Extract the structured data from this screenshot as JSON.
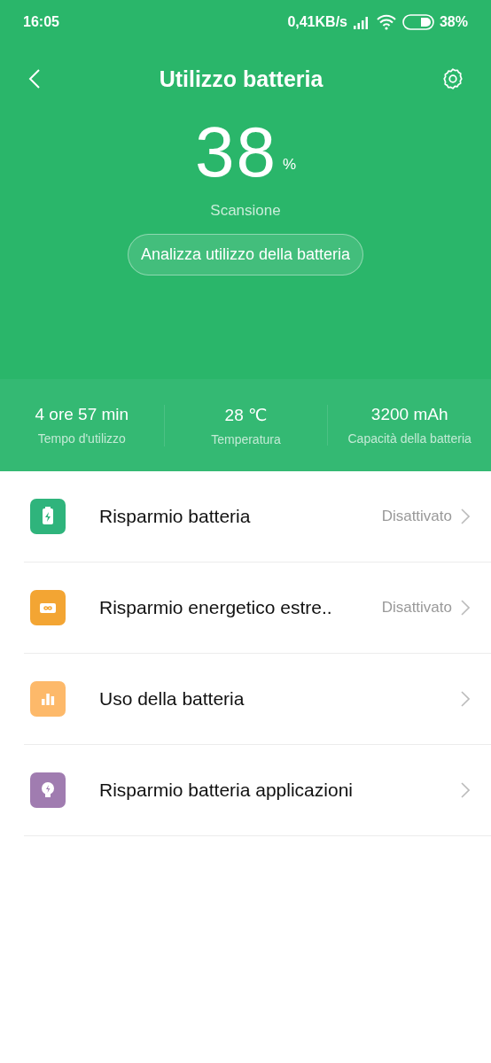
{
  "status_bar": {
    "time": "16:05",
    "speed": "0,41KB/s",
    "battery": "38%"
  },
  "header": {
    "title": "Utilizzo batteria",
    "percent": "38",
    "percent_unit": "%",
    "status": "Scansione",
    "action": "Analizza utilizzo della batteria"
  },
  "stats": [
    {
      "value": "4 ore 57 min",
      "label": "Tempo d'utilizzo"
    },
    {
      "value": "28 ℃",
      "label": "Temperatura"
    },
    {
      "value": "3200 mAh",
      "label": "Capacità della batteria"
    }
  ],
  "items": [
    {
      "kind": "battery",
      "color": "#2fb47c",
      "label": "Risparmio batteria",
      "value": "Disattivato"
    },
    {
      "kind": "infinity",
      "color": "#f3a533",
      "label": "Risparmio energetico estre..",
      "value": "Disattivato"
    },
    {
      "kind": "chart",
      "color": "#fdb96a",
      "label": "Uso della batteria"
    },
    {
      "kind": "bulb",
      "color": "#a07cb0",
      "label": "Risparmio batteria applicazioni"
    }
  ]
}
